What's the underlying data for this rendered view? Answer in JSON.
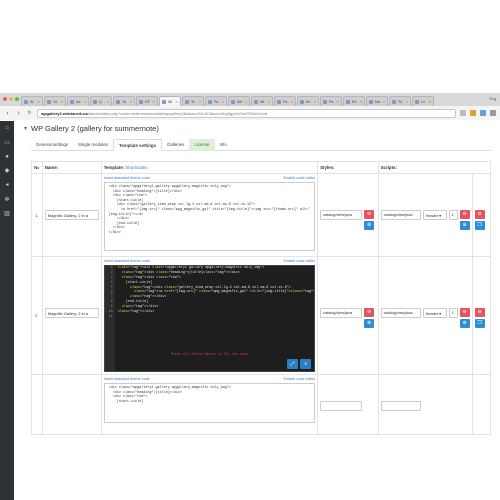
{
  "browser": {
    "tabs": [
      {
        "label": "W"
      },
      {
        "label": "Yo"
      },
      {
        "label": "Ka"
      },
      {
        "label": "Ц"
      },
      {
        "label": "Та"
      },
      {
        "label": "HT"
      },
      {
        "label": "Wi"
      },
      {
        "label": "Te"
      },
      {
        "label": "Pa"
      },
      {
        "label": "We"
      },
      {
        "label": "Wi"
      },
      {
        "label": "Pa"
      },
      {
        "label": "En"
      },
      {
        "label": "Pa"
      },
      {
        "label": "Re"
      },
      {
        "label": "Ma"
      },
      {
        "label": "Th"
      },
      {
        "label": "Lo"
      }
    ],
    "active_tab_index": 6,
    "user_label": "Org",
    "url_host": "wpgallery2.webka.mk.ua",
    "url_path": "/admin/index.php?route=extension/module/wpgallery2&token=5Jn2C8mohxKcjAgyUvGeKSSKnCmrd"
  },
  "page": {
    "title": "WP Gallery 2 (gallery for summernote)",
    "tabs": [
      "General settings",
      "Single modules",
      "Template settings",
      "Galleries",
      "License",
      "Info"
    ],
    "active_tab": "Template settings"
  },
  "table": {
    "headers": {
      "no": "№",
      "name": "Name:",
      "template": "Template:",
      "shortcodes": "Shortcodes",
      "styles": "Styles:",
      "scripts": "Scripts:"
    },
    "insert_link": "Insert standard theme code",
    "editor_link": "Enable code editor",
    "editor_hint": "Press Ctrl+Enter/Space to fit the code",
    "rows": [
      {
        "no": "1.",
        "name": "Magnific Gallery, 2 in a",
        "style": "catalog/view/java",
        "script": "catalog/view/java",
        "position": "Header",
        "order": "1",
        "code": "<div class=\"wpgallery2-gallery wpgallery-magnific only_img\">\n  <div class=\"heading\">[title]</div>\n  <div class=\"row\">\n    [start-cicle]\n    <div class=\"gallery_item_wrap col-lg-4 col-md-6 col-sm-6 col-xs-12\">\n      <a href=\"[img-src]\" class=\"wpg_magnific_gal\" title=\"[img-title]\"><img src=\"[thumb-src]\" alt=\"\n[img-title]\"></a>\n    </div>\n    [end-cicle]\n  </div>\n</div>"
      },
      {
        "no": "2.",
        "name": "Magnific Gallery, 2 in a",
        "style": "catalog/view/java",
        "script": "catalog/view/java",
        "position": "Header",
        "order": "1",
        "code_lines": [
          "<div class=\"wpgallery2 gallery wpgallery-magnific only_img\">",
          "  <div class=\"heading\">[title]</div>",
          "  <div class=\"row\">",
          "    [start-cicle]",
          "      <div class=\"gallery_item_wrap col-lg-4 col-md-6 col-sm-6 col-xs-6\">",
          "        <a href=\"[img-src]\" class=\"wpg_magnific_gal\" title=\"[img-title]\"><i",
          "      </div>",
          "    [end-cicle]",
          "  </div>",
          "</div>",
          ""
        ]
      },
      {
        "no": "3.",
        "code": "<div class=\"wpgallery2-gallery wpgallery-magnific only_img\">\n  <div class=\"heading\">[title]</div>\n  <div class=\"row\">\n    [start-cicle]"
      }
    ]
  },
  "colors": {
    "accent": "#3a7bc8",
    "danger": "#e4535e",
    "primary": "#2d8dd6",
    "sidebar": "#2f3235",
    "license": "#dff0d8"
  },
  "icons": [
    "home-icon",
    "monitor-icon",
    "user-icon",
    "share-icon",
    "gear-icon",
    "chart-icon",
    "tag-icon"
  ]
}
